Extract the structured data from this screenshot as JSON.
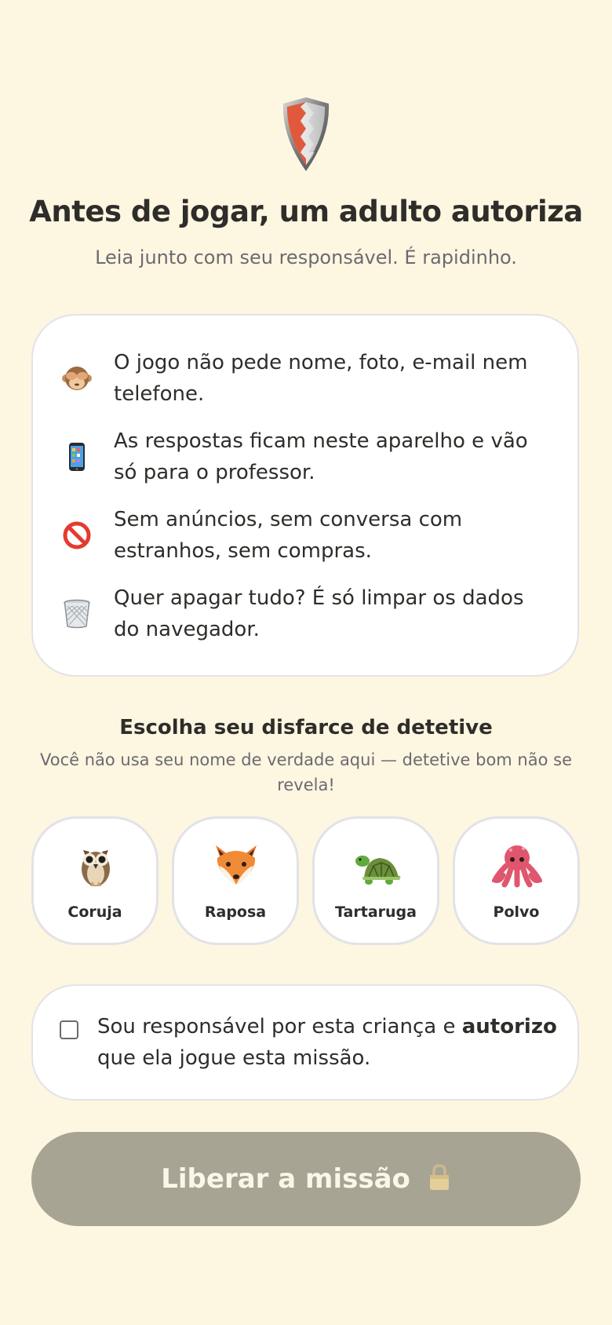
{
  "header": {
    "icon": "shield-icon",
    "title": "Antes de jogar, um adulto autoriza",
    "subtitle": "Leia junto com seu responsável. É rapidinho."
  },
  "info": {
    "items": [
      {
        "icon": "see-no-evil-monkey-icon",
        "text": "O jogo não pede nome, foto, e-mail nem telefone."
      },
      {
        "icon": "mobile-phone-icon",
        "text": "As respostas ficam neste aparelho e vão só para o professor."
      },
      {
        "icon": "prohibited-icon",
        "text": "Sem anúncios, sem conversa com estranhos, sem compras."
      },
      {
        "icon": "wastebasket-icon",
        "text": "Quer apagar tudo? É só limpar os dados do navegador."
      }
    ]
  },
  "disguise": {
    "title": "Escolha seu disfarce de detetive",
    "subtitle": "Você não usa seu nome de verdade aqui — detetive bom não se revela!",
    "options": [
      {
        "icon": "owl-icon",
        "label": "Coruja"
      },
      {
        "icon": "fox-icon",
        "label": "Raposa"
      },
      {
        "icon": "turtle-icon",
        "label": "Tartaruga"
      },
      {
        "icon": "octopus-icon",
        "label": "Polvo"
      }
    ]
  },
  "consent": {
    "checked": false,
    "text_before": "Sou responsável por esta criança e ",
    "text_bold": "autorizo",
    "text_after": " que ela jogue esta missão."
  },
  "cta": {
    "label": "Liberar a missão",
    "icon": "lock-icon",
    "disabled": true
  },
  "colors": {
    "background": "#fdf6e1",
    "card": "#ffffff",
    "cta_disabled": "#a8a494",
    "text": "#2f2d2a",
    "muted": "#6b6a70"
  }
}
